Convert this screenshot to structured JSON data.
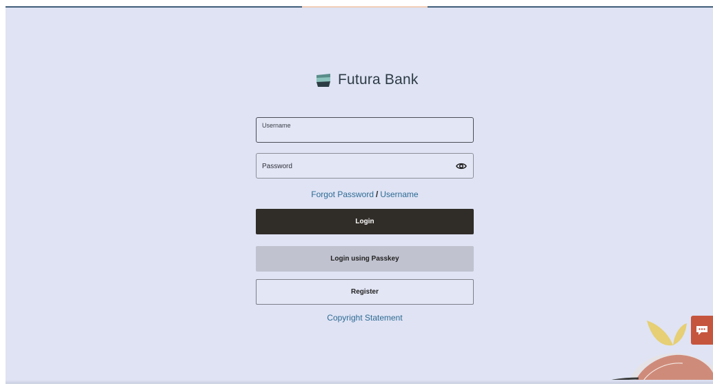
{
  "brand": {
    "name": "Futura Bank",
    "logo_icon": "futura-bank-logo-icon"
  },
  "form": {
    "username_label": "Username",
    "username_value": "",
    "password_label": "Password",
    "password_value": "",
    "password_toggle_icon": "eye-icon"
  },
  "links": {
    "forgot_password": "Forgot Password",
    "separator": "/",
    "username": "Username"
  },
  "buttons": {
    "login": "Login",
    "passkey": "Login using Passkey",
    "register": "Register"
  },
  "footer": {
    "copyright": "Copyright Statement"
  },
  "chat": {
    "icon": "chat-bubble-icon"
  },
  "colors": {
    "background": "#dfe3f4",
    "primary_button": "#302c28",
    "secondary_button": "#c0c2cf",
    "link": "#2d6a93",
    "chat_tab": "#c6553e"
  }
}
